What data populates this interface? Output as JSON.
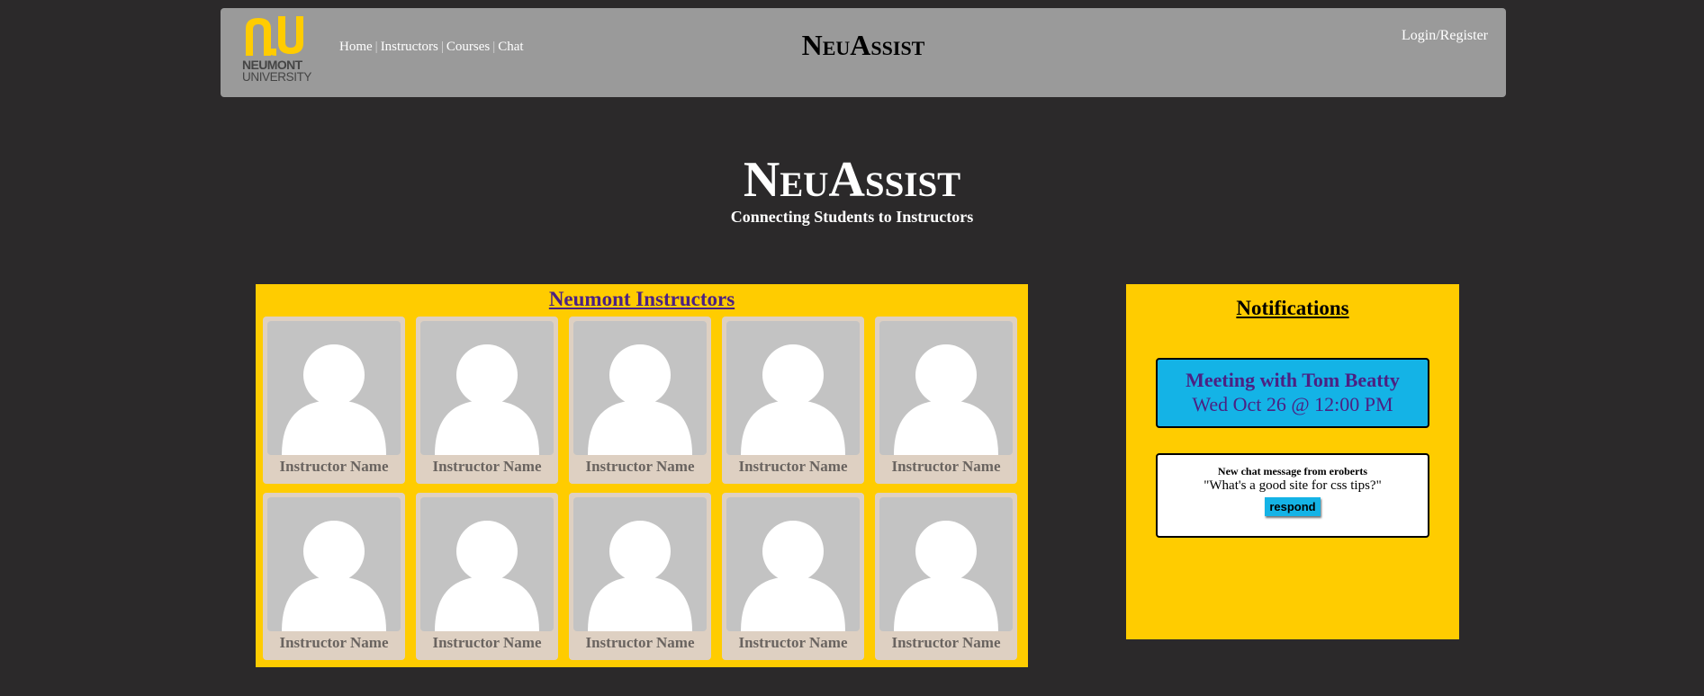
{
  "header": {
    "logo": {
      "line1": "NEUMONT",
      "line2": "UNIVERSITY",
      "mark_color": "#ffcc00",
      "icon": "neumont-nu-logo"
    },
    "nav": [
      {
        "label": "Home"
      },
      {
        "label": "Instructors"
      },
      {
        "label": "Courses"
      },
      {
        "label": "Chat"
      }
    ],
    "nav_separator": "|",
    "brand": "NeuAssist",
    "login_label": "Login/Register",
    "background": "#9a9a9a"
  },
  "hero": {
    "title": "NeuAssist",
    "subtitle": "Connecting Students to Instructors"
  },
  "instructors": {
    "title": "Neumont Instructors",
    "cards": [
      {
        "name": "Instructor Name",
        "icon": "profile-placeholder-icon"
      },
      {
        "name": "Instructor Name",
        "icon": "profile-placeholder-icon"
      },
      {
        "name": "Instructor Name",
        "icon": "profile-placeholder-icon"
      },
      {
        "name": "Instructor Name",
        "icon": "profile-placeholder-icon"
      },
      {
        "name": "Instructor Name",
        "icon": "profile-placeholder-icon"
      },
      {
        "name": "Instructor Name",
        "icon": "profile-placeholder-icon"
      },
      {
        "name": "Instructor Name",
        "icon": "profile-placeholder-icon"
      },
      {
        "name": "Instructor Name",
        "icon": "profile-placeholder-icon"
      },
      {
        "name": "Instructor Name",
        "icon": "profile-placeholder-icon"
      },
      {
        "name": "Instructor Name",
        "icon": "profile-placeholder-icon"
      }
    ]
  },
  "notifications": {
    "title": "Notifications",
    "meeting": {
      "title": "Meeting with Tom Beatty",
      "when": "Wed Oct 26 @ 12:00 PM"
    },
    "chat": {
      "heading": "New chat message from eroberts",
      "message": "\"What's a good site for css tips?\"",
      "respond_label": "respond"
    }
  },
  "colors": {
    "page_background": "#2b292a",
    "panel_yellow": "#ffcc00",
    "accent_purple": "#4b2183",
    "accent_blue": "#14b3e6",
    "card_background": "#ded0c2",
    "photo_background": "#c3c3c3"
  }
}
